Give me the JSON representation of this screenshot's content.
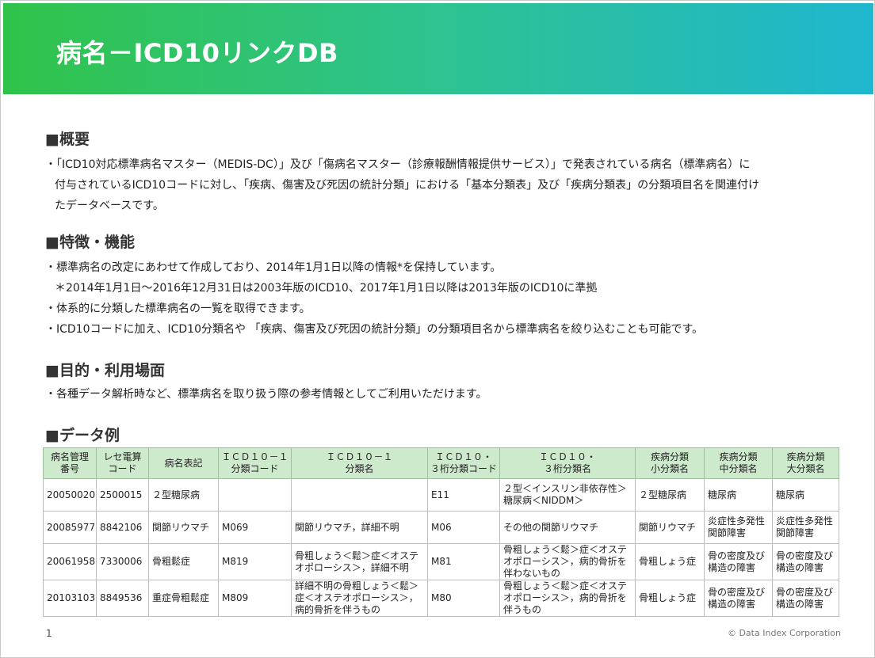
{
  "banner": {
    "title": "病名－ICD10リンクDB"
  },
  "sections": {
    "overview": {
      "heading": "■概要",
      "lines": [
        "・「ICD10対応標準病名マスター（MEDIS-DC）」及び「傷病名マスター（診療報酬情報提供サービス）」で発表されている病名（標準病名）に",
        "付与されているICD10コードに対し、「疾病、傷害及び死因の統計分類」における「基本分類表」及び「疾病分類表」の分類項目名を関連付け",
        "たデータベースです。"
      ]
    },
    "features": {
      "heading": "■特徴・機能",
      "lines": [
        "・標準病名の改定にあわせて作成しており、2014年1月1日以降の情報*を保持しています。",
        "＊2014年1月1日～2016年12月31日は2003年版のICD10、2017年1月1日以降は2013年版のICD10に準拠",
        "・体系的に分類した標準病名の一覧を取得できます。",
        "・ICD10コードに加え、ICD10分類名や 「疾病、傷害及び死因の統計分類」の分類項目名から標準病名を絞り込むことも可能です。"
      ]
    },
    "purpose": {
      "heading": "■目的・利用場面",
      "lines": [
        "・各種データ解析時など、標準病名を取り扱う際の参考情報としてご利用いただけます。"
      ]
    },
    "example": {
      "heading": "■データ例"
    }
  },
  "table": {
    "headers": [
      "病名管理\n番号",
      "レセ電算\nコード",
      "病名表記",
      "ＩＣＤ１０－１\n分類コード",
      "ＩＣＤ１０－１\n分類名",
      "ＩＣＤ１０・\n３桁分類コード",
      "ＩＣＤ１０・\n３桁分類名",
      "疾病分類\n小分類名",
      "疾病分類\n中分類名",
      "疾病分類\n大分類名"
    ],
    "rows": [
      [
        "20050020",
        "2500015",
        "２型糖尿病",
        "",
        "",
        "E11",
        "２型＜インスリン非依存性＞\n糖尿病＜NIDDM＞",
        "２型糖尿病",
        "糖尿病",
        "糖尿病"
      ],
      [
        "20085977",
        "8842106",
        "関節リウマチ",
        "M069",
        "関節リウマチ，詳細不明",
        "M06",
        "その他の関節リウマチ",
        "関節リウマチ",
        "炎症性多発性\n関節障害",
        "炎症性多発性\n関節障害"
      ],
      [
        "20061958",
        "7330006",
        "骨粗鬆症",
        "M819",
        "骨粗しょう＜鬆＞症＜オステ\nオポローシス＞，詳細不明",
        "M81",
        "骨粗しょう＜鬆＞症＜オステ\nオポローシス＞，病的骨折を\n伴わないもの",
        "骨粗しょう症",
        "骨の密度及び\n構造の障害",
        "骨の密度及び\n構造の障害"
      ],
      [
        "20103103",
        "8849536",
        "重症骨粗鬆症",
        "M809",
        "詳細不明の骨粗しょう＜鬆＞\n症＜オステオポローシス＞，\n病的骨折を伴うもの",
        "M80",
        "骨粗しょう＜鬆＞症＜オステ\nオポローシス＞，病的骨折を\n伴うもの",
        "骨粗しょう症",
        "骨の密度及び\n構造の障害",
        "骨の密度及び\n構造の障害"
      ]
    ]
  },
  "footer": {
    "page": "1",
    "copyright": "© Data Index Corporation"
  }
}
